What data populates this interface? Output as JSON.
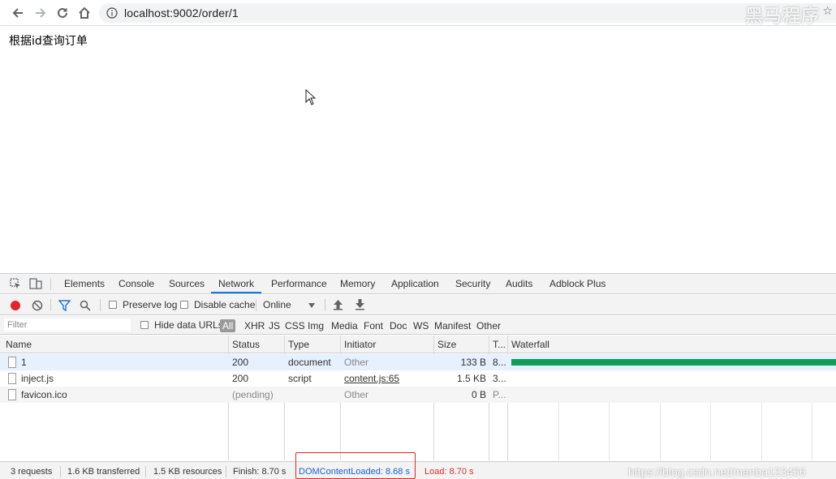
{
  "browser": {
    "url": "localhost:9002/order/1",
    "watermark": "黑马程序"
  },
  "page": {
    "text": "根据id查询订单"
  },
  "devtools": {
    "tabs": [
      "Elements",
      "Console",
      "Sources",
      "Network",
      "Performance",
      "Memory",
      "Application",
      "Security",
      "Audits",
      "Adblock Plus"
    ],
    "active_tab": "Network",
    "toolbar": {
      "preserve_log": "Preserve log",
      "disable_cache": "Disable cache",
      "throttle": "Online"
    },
    "filter": {
      "placeholder": "Filter",
      "hide_data_urls": "Hide data URLs",
      "types": [
        "All",
        "XHR",
        "JS",
        "CSS",
        "Img",
        "Media",
        "Font",
        "Doc",
        "WS",
        "Manifest",
        "Other"
      ]
    },
    "columns": [
      "Name",
      "Status",
      "Type",
      "Initiator",
      "Size",
      "T...",
      "Waterfall"
    ],
    "rows": [
      {
        "name": "1",
        "status": "200",
        "type": "document",
        "initiator": "Other",
        "size": "133 B",
        "time": "8..."
      },
      {
        "name": "inject.js",
        "status": "200",
        "type": "script",
        "initiator": "content.js:65",
        "size": "1.5 KB",
        "time": "3..."
      },
      {
        "name": "favicon.ico",
        "status": "(pending)",
        "type": "",
        "initiator": "Other",
        "size": "0 B",
        "time": "P..."
      }
    ],
    "status": {
      "requests": "3 requests",
      "transferred": "1.6 KB transferred",
      "resources": "1.5 KB resources",
      "finish": "Finish: 8.70 s",
      "dom_content_loaded": "DOMContentLoaded: 8.68 s",
      "load": "Load: 8.70 s"
    },
    "watermark": "https://blog.csdn.net/manba123456"
  },
  "colors": {
    "accent": "#1a73e8",
    "record_red": "#e3242b",
    "waterfall_green": "#0f9d58",
    "selected_row": "#e7f0fd",
    "dcl_blue": "#1a5fd6",
    "load_red": "#d93025"
  }
}
